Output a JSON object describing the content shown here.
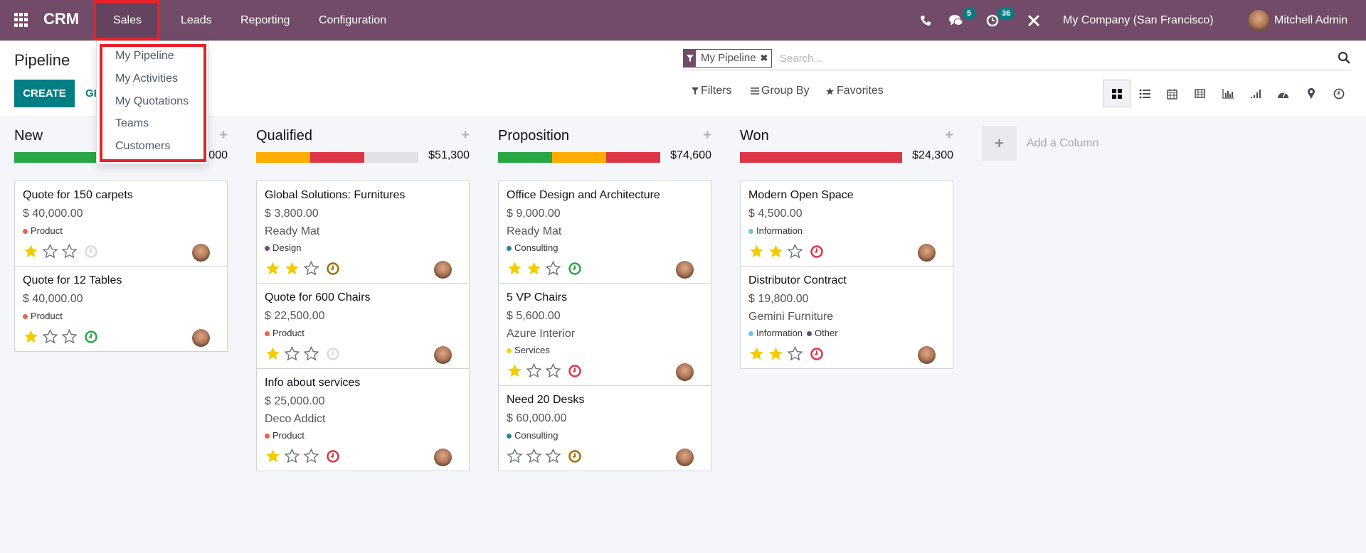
{
  "navbar": {
    "app_name": "CRM",
    "menu": [
      "Sales",
      "Leads",
      "Reporting",
      "Configuration"
    ],
    "chat_badge": "5",
    "activity_badge": "36",
    "company": "My Company (San Francisco)",
    "user": "Mitchell Admin",
    "bg_color": "#714B67"
  },
  "sales_dropdown": {
    "items": [
      "My Pipeline",
      "My Activities",
      "My Quotations",
      "Teams",
      "Customers"
    ]
  },
  "control_panel": {
    "title": "Pipeline",
    "create_label": "CREATE",
    "generate_label": "GI",
    "search": {
      "facet_label": "My Pipeline",
      "placeholder": "Search..."
    },
    "filters_label": "Filters",
    "groupby_label": "Group By",
    "favorites_label": "Favorites",
    "views": [
      "kanban",
      "list",
      "calendar",
      "pivot",
      "graph",
      "cohort",
      "dashboard",
      "map",
      "activity"
    ],
    "active_view": "kanban"
  },
  "kanban": {
    "add_column_label": "Add a Column",
    "columns": [
      {
        "title": "New",
        "total": "$80,000",
        "progress": [
          {
            "color": "#28a745",
            "fraction": 1.0
          }
        ],
        "cards": [
          {
            "title": "Quote for 150 carpets",
            "amount": "$ 40,000.00",
            "company": "",
            "tags": [
              {
                "label": "Product",
                "color": "#f06050"
              }
            ],
            "stars": 1,
            "activity": "none"
          },
          {
            "title": "Quote for 12 Tables",
            "amount": "$ 40,000.00",
            "company": "",
            "tags": [
              {
                "label": "Product",
                "color": "#f06050"
              }
            ],
            "stars": 1,
            "activity": "planned"
          }
        ]
      },
      {
        "title": "Qualified",
        "total": "$51,300",
        "progress": [
          {
            "color": "#ffac00",
            "fraction": 0.3333
          },
          {
            "color": "#dc3545",
            "fraction": 0.3333
          }
        ],
        "cards": [
          {
            "title": "Global Solutions: Furnitures",
            "amount": "$ 3,800.00",
            "company": "Ready Mat",
            "tags": [
              {
                "label": "Design",
                "color": "#814968"
              }
            ],
            "stars": 2,
            "activity": "today"
          },
          {
            "title": "Quote for 600 Chairs",
            "amount": "$ 22,500.00",
            "company": "",
            "tags": [
              {
                "label": "Product",
                "color": "#f06050"
              }
            ],
            "stars": 1,
            "activity": "none"
          },
          {
            "title": "Info about services",
            "amount": "$ 25,000.00",
            "company": "Deco Addict",
            "tags": [
              {
                "label": "Product",
                "color": "#f06050"
              }
            ],
            "stars": 1,
            "activity": "overdue"
          }
        ]
      },
      {
        "title": "Proposition",
        "total": "$74,600",
        "progress": [
          {
            "color": "#28a745",
            "fraction": 0.3333
          },
          {
            "color": "#ffac00",
            "fraction": 0.3333
          },
          {
            "color": "#dc3545",
            "fraction": 0.3334
          }
        ],
        "cards": [
          {
            "title": "Office Design and Architecture",
            "amount": "$ 9,000.00",
            "company": "Ready Mat",
            "tags": [
              {
                "label": "Consulting",
                "color": "#2c8397"
              }
            ],
            "stars": 2,
            "activity": "planned"
          },
          {
            "title": "5 VP Chairs",
            "amount": "$ 5,600.00",
            "company": "Azure Interior",
            "tags": [
              {
                "label": "Services",
                "color": "#f7cd1f"
              }
            ],
            "stars": 1,
            "activity": "overdue"
          },
          {
            "title": "Need 20 Desks",
            "amount": "$ 60,000.00",
            "company": "",
            "tags": [
              {
                "label": "Consulting",
                "color": "#2c8397"
              }
            ],
            "stars": 0,
            "activity": "today"
          }
        ]
      },
      {
        "title": "Won",
        "total": "$24,300",
        "progress": [
          {
            "color": "#dc3545",
            "fraction": 1.0
          }
        ],
        "cards": [
          {
            "title": "Modern Open Space",
            "amount": "$ 4,500.00",
            "company": "",
            "tags": [
              {
                "label": "Information",
                "color": "#6cc1ed"
              }
            ],
            "stars": 2,
            "activity": "overdue"
          },
          {
            "title": "Distributor Contract",
            "amount": "$ 19,800.00",
            "company": "Gemini Furniture",
            "tags": [
              {
                "label": "Information",
                "color": "#6cc1ed"
              },
              {
                "label": "Other",
                "color": "#475577"
              }
            ],
            "stars": 2,
            "activity": "overdue"
          }
        ]
      }
    ]
  },
  "activity_colors": {
    "none": "#d8dadd",
    "planned": "#28a745",
    "today": "#a36e00",
    "overdue": "#dc3545"
  }
}
